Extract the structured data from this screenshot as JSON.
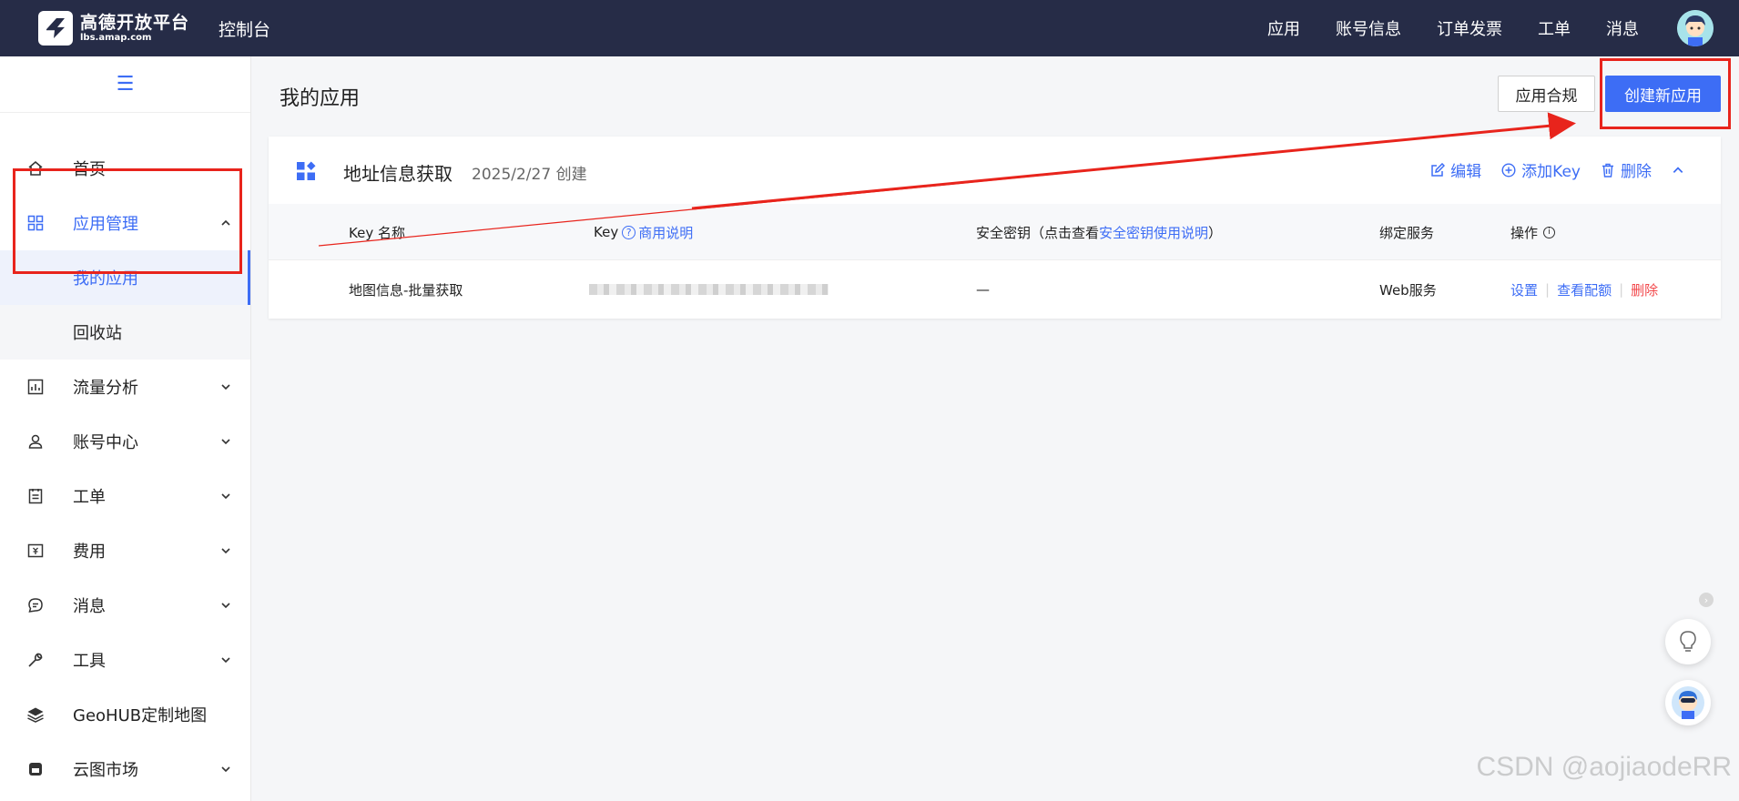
{
  "topbar": {
    "logo_title": "高德开放平台",
    "logo_sub": "lbs.amap.com",
    "console": "控制台",
    "nav": [
      "应用",
      "账号信息",
      "订单发票",
      "工单",
      "消息"
    ]
  },
  "sidebar": {
    "collapse_icon": "menu-icon",
    "items": [
      {
        "label": "首页",
        "icon": "home-icon"
      },
      {
        "label": "应用管理",
        "icon": "app-grid-icon"
      },
      {
        "label": "我的应用"
      },
      {
        "label": "回收站"
      },
      {
        "label": "流量分析",
        "icon": "chart-icon"
      },
      {
        "label": "账号中心",
        "icon": "user-icon"
      },
      {
        "label": "工单",
        "icon": "ticket-icon"
      },
      {
        "label": "费用",
        "icon": "fee-icon"
      },
      {
        "label": "消息",
        "icon": "message-icon"
      },
      {
        "label": "工具",
        "icon": "wrench-icon"
      },
      {
        "label": "GeoHUB定制地图",
        "icon": "layers-icon"
      },
      {
        "label": "云图市场",
        "icon": "store-icon"
      }
    ]
  },
  "main": {
    "title": "我的应用",
    "compliance_button": "应用合规",
    "create_button": "创建新应用",
    "app": {
      "name": "地址信息获取",
      "date": "2025/2/27 创建",
      "actions": {
        "edit": "编辑",
        "add_key": "添加Key",
        "delete": "删除"
      }
    },
    "table": {
      "headers": {
        "key_name": "Key 名称",
        "key": "Key",
        "key_link": "商用说明",
        "secret_prefix": "安全密钥（点击查看",
        "secret_link": "安全密钥使用说明",
        "secret_suffix": "）",
        "service": "绑定服务",
        "ops": "操作"
      },
      "row": {
        "key_name": "地图信息-批量获取",
        "secret": "—",
        "service": "Web服务",
        "op_settings": "设置",
        "op_quota": "查看配额",
        "op_delete": "删除"
      }
    }
  },
  "colors": {
    "accent": "#3d6df5",
    "topbar": "#262c47",
    "danger": "#f2484b",
    "highlight": "#e8241c"
  },
  "watermark": "CSDN @aojiaodeRR"
}
